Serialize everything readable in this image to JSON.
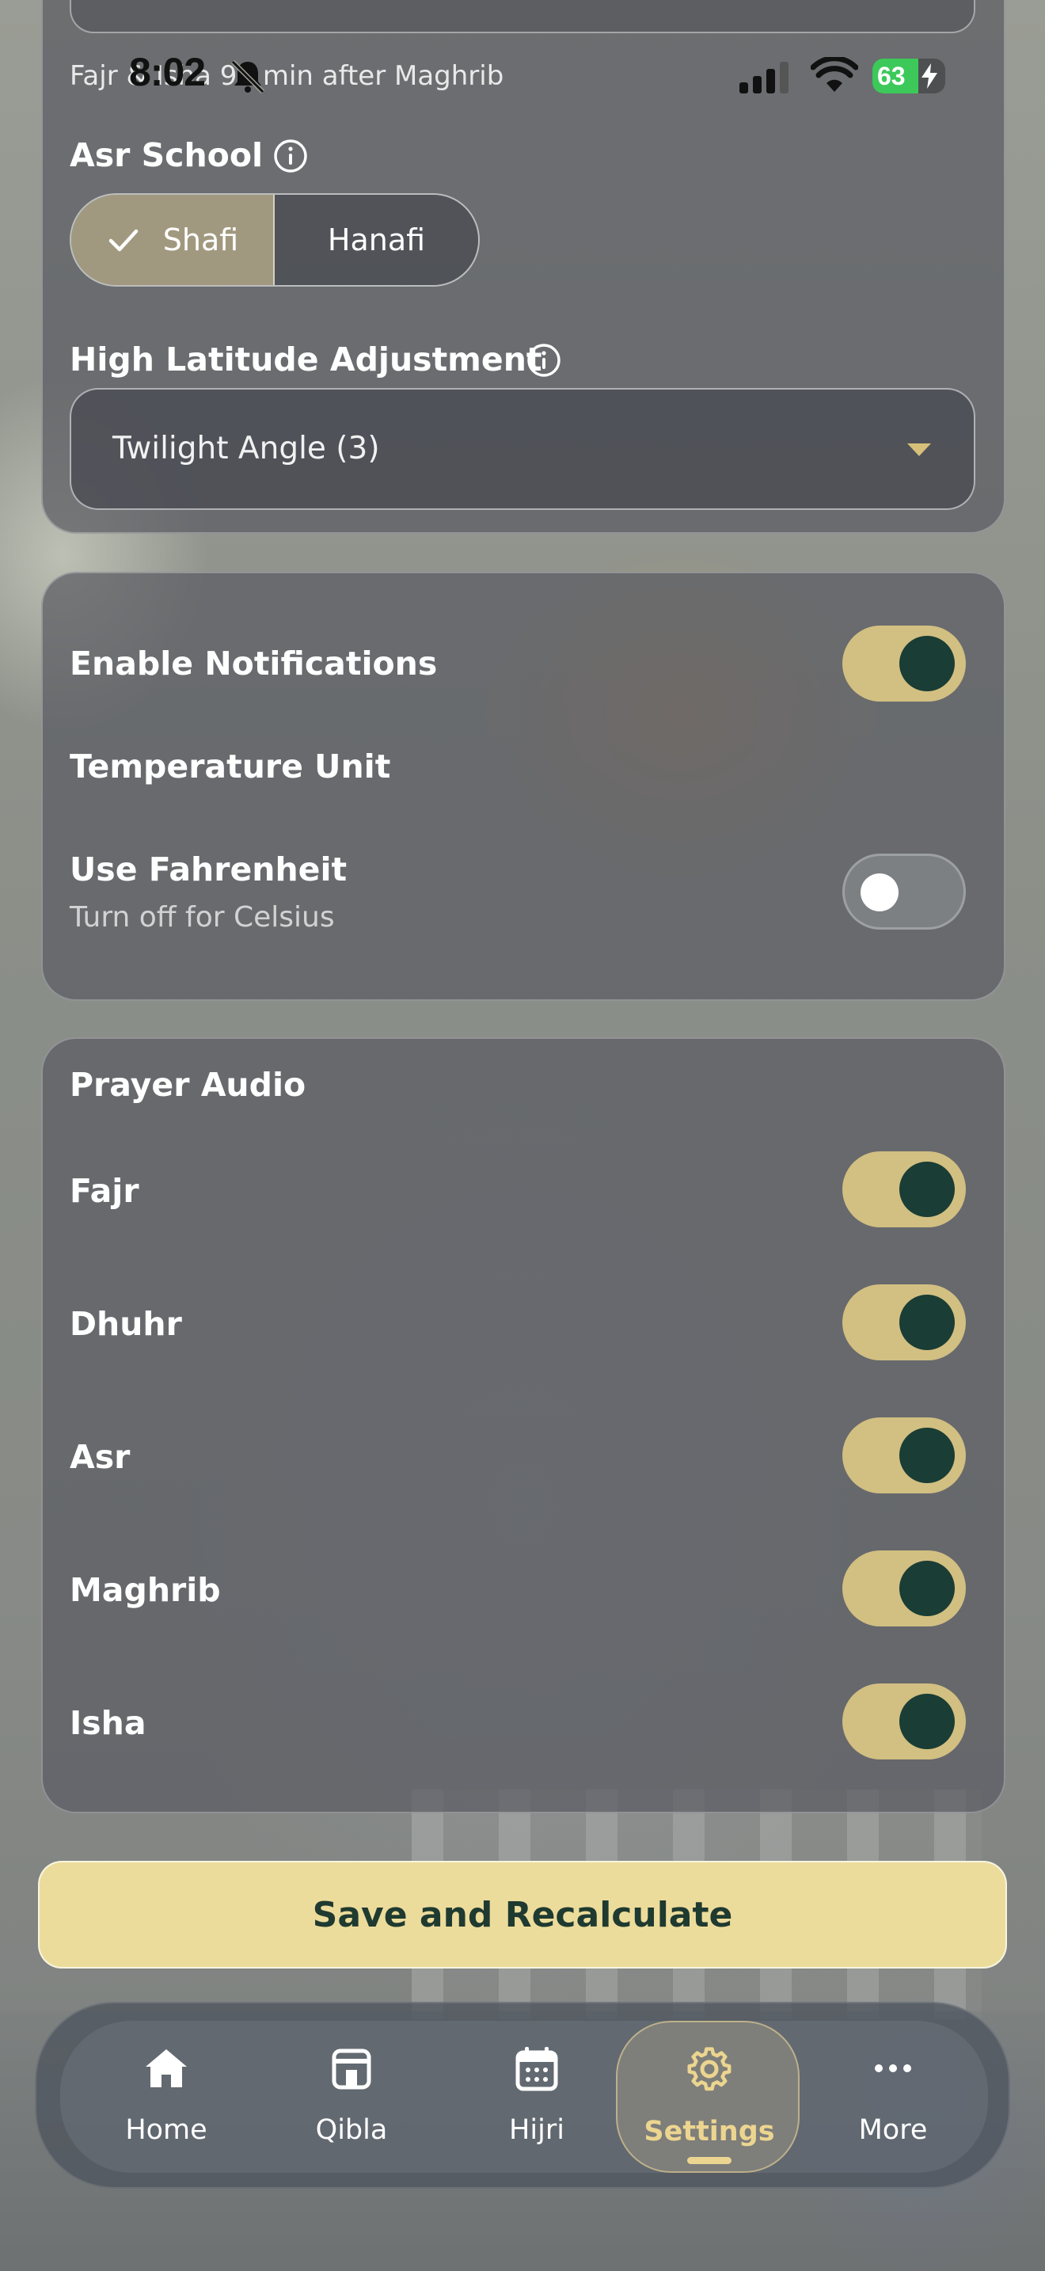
{
  "status_bar": {
    "time": "8:02",
    "battery_level": "63",
    "battery_fraction": 0.63,
    "icons": [
      "bell-slash-icon",
      "cellular-signal-icon",
      "wifi-icon",
      "battery-icon",
      "charging-bolt-icon"
    ]
  },
  "prayer_settings": {
    "fajr_isha_note": "Fajr & Isha 90 min after Maghrib",
    "asr_school": {
      "label": "Asr School",
      "options": [
        "Shafi",
        "Hanafi"
      ],
      "selected": "Shafi"
    },
    "high_latitude": {
      "label": "High Latitude Adjustment",
      "value": "Twilight Angle (3)"
    }
  },
  "notifications": {
    "enable_label": "Enable Notifications",
    "enable_on": true,
    "temperature_section": "Temperature Unit",
    "fahrenheit_label": "Use Fahrenheit",
    "fahrenheit_sub": "Turn off for Celsius",
    "fahrenheit_on": false
  },
  "prayer_audio": {
    "title": "Prayer Audio",
    "items": [
      {
        "label": "Fajr",
        "on": true
      },
      {
        "label": "Dhuhr",
        "on": true
      },
      {
        "label": "Asr",
        "on": true
      },
      {
        "label": "Maghrib",
        "on": true
      },
      {
        "label": "Isha",
        "on": true
      }
    ]
  },
  "save_button": {
    "label": "Save and Recalculate"
  },
  "tab_bar": {
    "tabs": [
      {
        "label": "Home",
        "icon": "home-icon"
      },
      {
        "label": "Qibla",
        "icon": "kaaba-icon"
      },
      {
        "label": "Hijri",
        "icon": "calendar-icon"
      },
      {
        "label": "Settings",
        "icon": "gear-icon"
      },
      {
        "label": "More",
        "icon": "ellipsis-icon"
      }
    ],
    "active": "Settings"
  },
  "colors": {
    "accent_gold": "#d2bf82",
    "toggle_knob_dark_green": "#1a3d35",
    "save_button_bg": "#ecdc9b",
    "active_tab_text": "#ecd590"
  }
}
